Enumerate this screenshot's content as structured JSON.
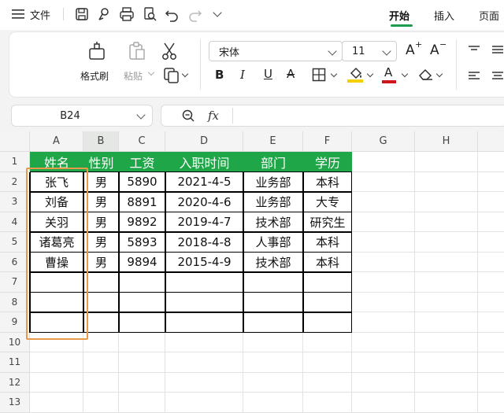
{
  "menubar": {
    "menu_icon": "hamburger-icon",
    "file_label": "文件",
    "tabs": [
      {
        "label": "开始",
        "active": true
      },
      {
        "label": "插入",
        "active": false
      },
      {
        "label": "页面",
        "active": false
      }
    ]
  },
  "ribbon": {
    "format_painter_label": "格式刷",
    "paste_label": "粘贴",
    "font_name": "宋体",
    "font_size": "11",
    "bold_glyph": "B",
    "italic_glyph": "I",
    "underline_glyph": "U",
    "strike_glyph": "A",
    "grow_glyph": "A",
    "shrink_glyph": "A",
    "highlight_color": "#f5d000",
    "font_color": "#d0161d"
  },
  "formula_bar": {
    "name_box": "B24",
    "fx_label": "fx",
    "formula_value": ""
  },
  "sheet": {
    "columns": [
      "A",
      "B",
      "C",
      "D",
      "E",
      "F",
      "G",
      "H"
    ],
    "active_column": "B",
    "rows": [
      "1",
      "2",
      "3",
      "4",
      "5",
      "6",
      "7",
      "8",
      "9",
      "10",
      "11",
      "12",
      "13",
      "14"
    ],
    "header": [
      "姓名",
      "性别",
      "工资",
      "入职时间",
      "部门",
      "学历"
    ],
    "header_color": "#1fa648",
    "data": [
      [
        "张飞",
        "男",
        "5890",
        "2021-4-5",
        "业务部",
        "本科"
      ],
      [
        "刘备",
        "男",
        "8891",
        "2020-4-6",
        "业务部",
        "大专"
      ],
      [
        "关羽",
        "男",
        "9892",
        "2019-4-7",
        "技术部",
        "研究生"
      ],
      [
        "诸葛亮",
        "男",
        "5893",
        "2018-4-8",
        "人事部",
        "本科"
      ],
      [
        "曹操",
        "男",
        "9894",
        "2015-4-9",
        "技术部",
        "本科"
      ]
    ],
    "highlight_color": "#e89a4c"
  }
}
